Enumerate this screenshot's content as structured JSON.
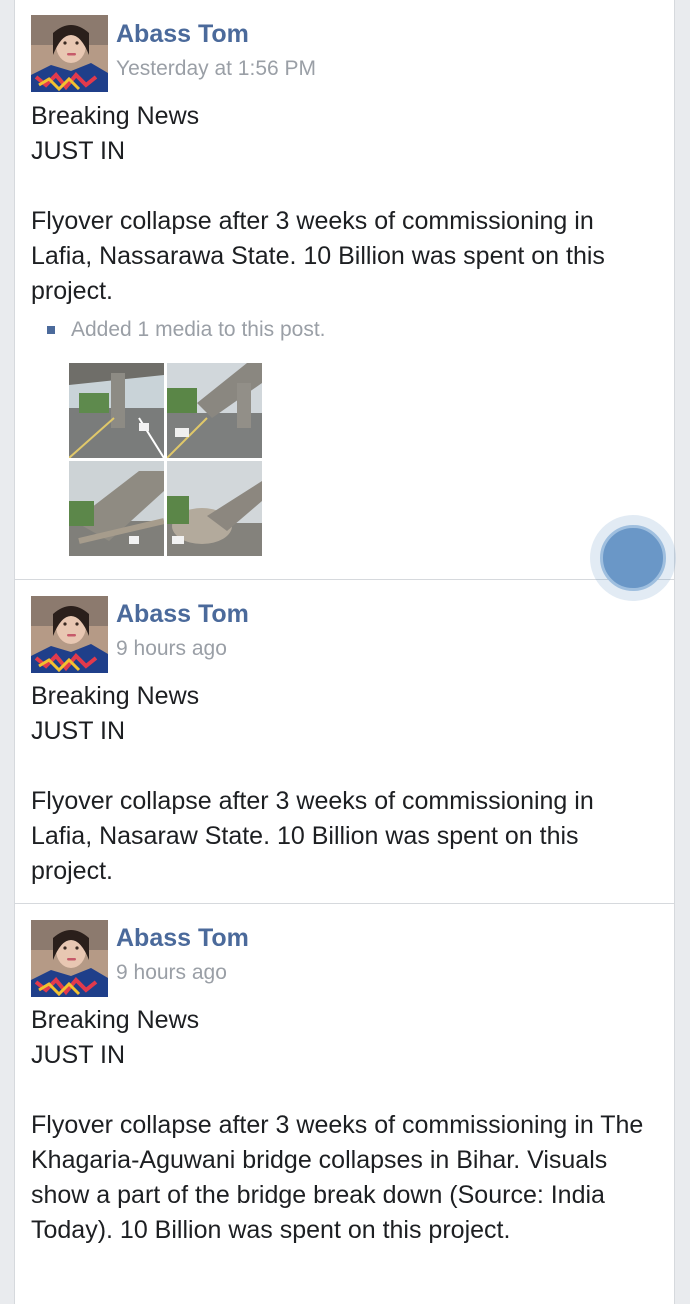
{
  "posts": [
    {
      "author": "Abass Tom",
      "time": "Yesterday at 1:56 PM",
      "line1": "Breaking News",
      "line2": "JUST IN",
      "text": "Flyover collapse after 3 weeks of commissioning in Lafia, Nassarawa State. 10 Billion was spent on this project.",
      "media_note": "Added 1 media to this post."
    },
    {
      "author": "Abass Tom",
      "time": "9 hours ago",
      "line1": "Breaking News",
      "line2": "JUST IN",
      "text": "Flyover collapse after 3 weeks of commissioning in Lafia, Nasaraw State. 10 Billion was spent on this project."
    },
    {
      "author": "Abass Tom",
      "time": "9 hours ago",
      "line1": "Breaking News",
      "line2": "JUST IN",
      "text": "Flyover collapse after 3 weeks of commissioning in The Khagaria-Aguwani bridge collapses in Bihar. Visuals show a part of the bridge break down (Source: India Today). 10 Billion was spent on this project."
    }
  ],
  "colors": {
    "author": "#4b6a9b",
    "timestamp": "#9a9fa6",
    "fab": "#6a97c7"
  }
}
